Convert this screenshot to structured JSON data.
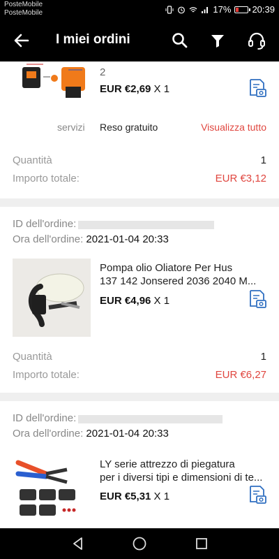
{
  "status_bar": {
    "carrier_1": "PosteMobile",
    "carrier_2": "PosteMobile",
    "battery": "17%",
    "time": "20:39"
  },
  "app_bar": {
    "title": "I miei ordini",
    "icons": [
      "back-arrow-icon",
      "search-icon",
      "filter-icon",
      "headset-icon"
    ]
  },
  "orders": [
    {
      "title_fragment": "2",
      "price": "EUR €2,69",
      "qty_suffix": "X 1",
      "services_label": "servizi",
      "services_value": "Reso gratuito",
      "show_all_link": "Visualizza tutto",
      "quantity_label": "Quantità",
      "quantity_value": "1",
      "total_label": "Importo totale:",
      "total_value": "EUR €3,12"
    },
    {
      "id_label": "ID dell'ordine:",
      "time_label": "Ora dell'ordine:",
      "time_value": "2021-01-04 20:33",
      "title_line1": "Pompa olio Oliatore Per Hus",
      "title_line2": "137 142 Jonsered 2036 2040 M...",
      "price": "EUR €4,96",
      "qty_suffix": "X 1",
      "quantity_label": "Quantità",
      "quantity_value": "1",
      "total_label": "Importo totale:",
      "total_value": "EUR €6,27"
    },
    {
      "id_label": "ID dell'ordine:",
      "time_label": "Ora dell'ordine:",
      "time_value": "2021-01-04 20:33",
      "title_line1": "LY serie attrezzo di piegatura",
      "title_line2": "per i diversi tipi e dimensioni di te...",
      "price": "EUR €5,31",
      "qty_suffix": "X 1"
    }
  ],
  "colors": {
    "accent_red": "#e0463f",
    "photo_icon_blue": "#2f6fc1"
  }
}
